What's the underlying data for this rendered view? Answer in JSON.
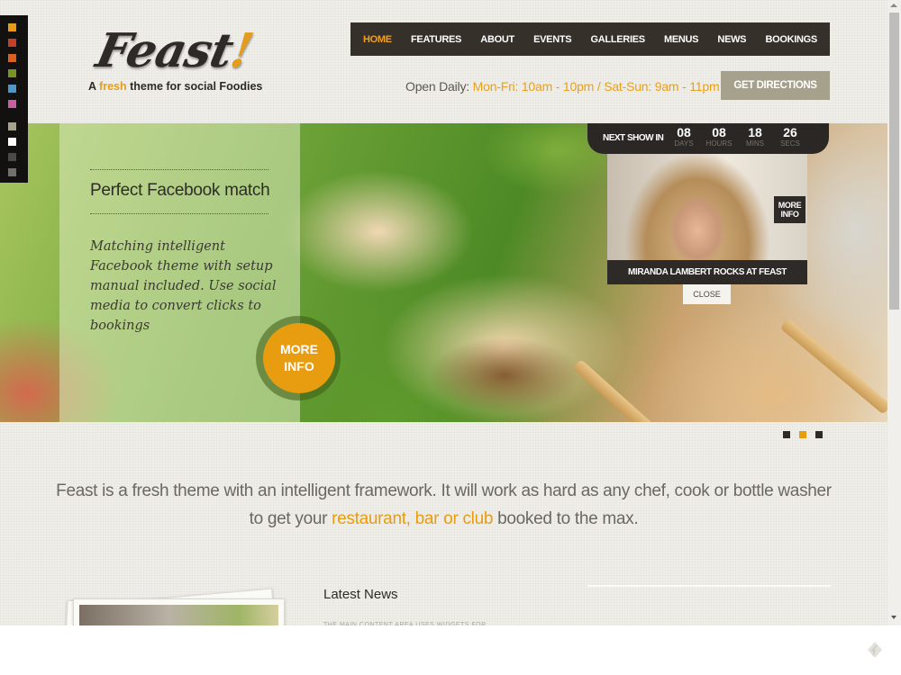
{
  "style_switcher": {
    "swatches": [
      {
        "name": "orange",
        "color": "#e59c1a"
      },
      {
        "name": "red",
        "color": "#c53f2c"
      },
      {
        "name": "burnt-orange",
        "color": "#d9601f"
      },
      {
        "name": "olive",
        "color": "#7a9324"
      },
      {
        "name": "blue",
        "color": "#4e97c9"
      },
      {
        "name": "pink",
        "color": "#c65ea0"
      },
      {
        "name": "khaki",
        "color": "#a8a48c"
      },
      {
        "name": "white",
        "color": "#ffffff"
      },
      {
        "name": "dark-gray",
        "color": "#4a4a48"
      },
      {
        "name": "gray",
        "color": "#6f6f6d"
      }
    ]
  },
  "logo": {
    "word": "Feast",
    "bang": "!",
    "tagline_pre": "A ",
    "tagline_accent": "fresh",
    "tagline_post": " theme for social Foodies"
  },
  "nav": {
    "items": [
      {
        "label": "HOME",
        "active": true
      },
      {
        "label": "FEATURES",
        "active": false
      },
      {
        "label": "ABOUT",
        "active": false
      },
      {
        "label": "EVENTS",
        "active": false
      },
      {
        "label": "GALLERIES",
        "active": false
      },
      {
        "label": "MENUS",
        "active": false
      },
      {
        "label": "NEWS",
        "active": false
      },
      {
        "label": "BOOKINGS",
        "active": false
      }
    ]
  },
  "hours": {
    "label": "Open Daily: ",
    "value": "Mon-Fri: 10am - 10pm / Sat-Sun: 9am - 11pm"
  },
  "directions_button": "GET DIRECTIONS",
  "slider": {
    "caption_title": "Perfect Facebook match",
    "caption_body": "Matching intelligent Facebook theme with setup manual included. Use social media to convert clicks to bookings",
    "more_info": [
      "MORE",
      "INFO"
    ],
    "active_slide": 2,
    "slide_count": 3
  },
  "countdown": {
    "label": "NEXT SHOW IN",
    "units": [
      {
        "value": "08",
        "caption": "DAYS"
      },
      {
        "value": "08",
        "caption": "HOURS"
      },
      {
        "value": "18",
        "caption": "MINS"
      },
      {
        "value": "26",
        "caption": "SECS"
      }
    ]
  },
  "event": {
    "more_info": [
      "MORE",
      "INFO"
    ],
    "title": "MIRANDA LAMBERT ROCKS AT FEAST",
    "close": "CLOSE"
  },
  "intro": {
    "pre": "Feast is a fresh theme with an intelligent framework. It will work as hard as any chef, cook or bottle washer to get your ",
    "accent": "restaurant, bar or club",
    "post": " booked to the max."
  },
  "news": {
    "title": "Latest News",
    "subtitle": "THE MAIN CONTENT AREA USES WIDGETS FOR"
  },
  "colors": {
    "accent": "#e89c0f",
    "nav_bg": "#36302b",
    "button_khaki": "#a5a18d"
  }
}
